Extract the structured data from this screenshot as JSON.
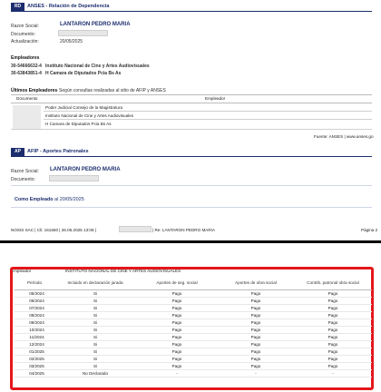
{
  "rd_section": {
    "badge": "RD",
    "title": "ANSES - Relación de Dependencia",
    "razon_social_label": "Razon Social:",
    "razon_social_value": "LANTARON PEDRO MARIA",
    "documento_label": "Documento:",
    "actualizacion_label": "Actualización:",
    "actualizacion_value": "20/05/2025"
  },
  "empleadores": {
    "heading": "Empleadores",
    "rows": [
      {
        "cuit": "30-54666632-4",
        "nombre": "Instituto Nacional de Cine y Artes Audiovisuales"
      },
      {
        "cuit": "30-63843851-4",
        "nombre": "H Camara de Diputados Pcia Bs As"
      }
    ]
  },
  "ultimos": {
    "heading": "Últimos Empleadores",
    "note": " - Según consultas realizadas al sitio de AFIP y ANSES",
    "col_documento": "Documento",
    "col_empleador": "Empleador",
    "rows": [
      "Poder Judicial Consejo de la Magistratura",
      "Instituto Nacional de Cine y Artes Audiovisuales",
      "H Camara de Diputados Pcia Bs As"
    ],
    "fuente": "Fuente: ANSES  |  www.anses.go"
  },
  "ap_section": {
    "badge": "AP",
    "title": "AFIP - Aportes Patronales",
    "razon_social_label": "Razon Social:",
    "razon_social_value": "LANTARON PEDRO MARIA",
    "documento_label": "Documento:",
    "como_empleado_label": "Como Empleado",
    "como_empleado_al": " al 20/05/2025"
  },
  "footer": {
    "left": "NOSIS SAC  |  Cli: 161560  |  26.05.2025 13:08  |",
    "right_ref": "|  Re: LANTARON PEDRO MARIA",
    "page": "Página 2"
  },
  "lower": {
    "empleador_label": "Empleador",
    "empleador_value": "INSTITUTO NACIONAL DE CINE Y ARTES AUDIOVISUALES"
  },
  "contrib_table": {
    "headers": [
      "Período",
      "Incluido en declaración jurada",
      "Aportes de seg. social",
      "Aportes de obra social",
      "Contrib. patronal obra social"
    ],
    "rows": [
      [
        "05/2024",
        "Si",
        "Pago",
        "Pago",
        "Pago"
      ],
      [
        "06/2024",
        "Si",
        "Pago",
        "Pago",
        "Pago"
      ],
      [
        "07/2024",
        "Si",
        "Pago",
        "Pago",
        "Pago"
      ],
      [
        "08/2024",
        "Si",
        "Pago",
        "Pago",
        "Pago"
      ],
      [
        "09/2024",
        "Si",
        "Pago",
        "Pago",
        "Pago"
      ],
      [
        "10/2024",
        "Si",
        "Pago",
        "Pago",
        "Pago"
      ],
      [
        "11/2024",
        "Si",
        "Pago",
        "Pago",
        "Pago"
      ],
      [
        "12/2024",
        "Si",
        "Pago",
        "Pago",
        "Pago"
      ],
      [
        "01/2025",
        "Si",
        "Pago",
        "Pago",
        "Pago"
      ],
      [
        "02/2025",
        "Si",
        "Pago",
        "Pago",
        "Pago"
      ],
      [
        "03/2025",
        "Si",
        "Pago",
        "Pago",
        "Pago"
      ],
      [
        "04/2025",
        "No Declarado",
        "-",
        "-",
        "-"
      ]
    ]
  },
  "colors": {
    "navy": "#1c2d6e",
    "pago_green": "#1f9d1f",
    "highlight_red": "#e3171b"
  }
}
